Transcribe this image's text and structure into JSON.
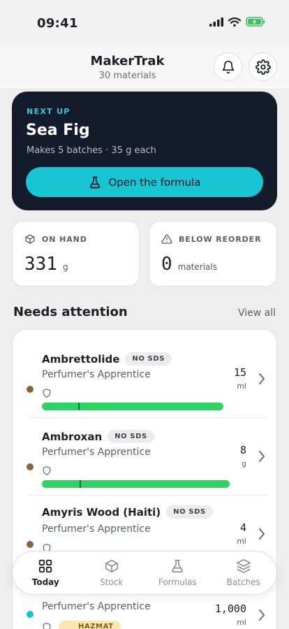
{
  "status": {
    "time": "09:41"
  },
  "header": {
    "title": "MakerTrak",
    "subtitle": "30 materials"
  },
  "next_up": {
    "label": "NEXT UP",
    "name": "Sea Fig",
    "meta": "Makes 5 batches · 35 g each",
    "button_label": "Open the formula"
  },
  "stats": {
    "on_hand": {
      "label": "ON HAND",
      "value": "331",
      "unit": "g"
    },
    "below_reorder": {
      "label": "BELOW REORDER",
      "value": "0",
      "unit": "materials"
    }
  },
  "attention": {
    "title": "Needs attention",
    "view_all": "View all",
    "items": [
      {
        "name": "Ambrettolide",
        "badge": "NO SDS",
        "supplier": "Perfumer's Apprentice",
        "qty": "15",
        "unit": "ml",
        "dot_color": "#8b6336",
        "level": 0.86
      },
      {
        "name": "Ambroxan",
        "badge": "NO SDS",
        "supplier": "Perfumer's Apprentice",
        "qty": "8",
        "unit": "g",
        "dot_color": "#8b6336",
        "level": 0.88
      },
      {
        "name": "Amyris Wood (Haiti)",
        "badge": "NO SDS",
        "supplier": "Perfumer's Apprentice",
        "qty": "4",
        "unit": "ml",
        "dot_color": "#8b6336"
      },
      {
        "name": "",
        "badge": "",
        "supplier": "Perfumer's Apprentice",
        "qty": "1,000",
        "unit": "ml",
        "dot_color": "#13c4d4",
        "tag": "HAZMAT"
      }
    ]
  },
  "tabs": [
    {
      "label": "Today",
      "icon": "grid-icon",
      "active": true
    },
    {
      "label": "Stock",
      "icon": "box-icon",
      "active": false
    },
    {
      "label": "Formulas",
      "icon": "flask-icon",
      "active": false
    },
    {
      "label": "Batches",
      "icon": "layers-icon",
      "active": false
    }
  ],
  "colors": {
    "accent": "#17c5d3",
    "dark": "#141b2b",
    "bar": "#2ed364",
    "hazmat_bg": "#fbe7b4"
  }
}
